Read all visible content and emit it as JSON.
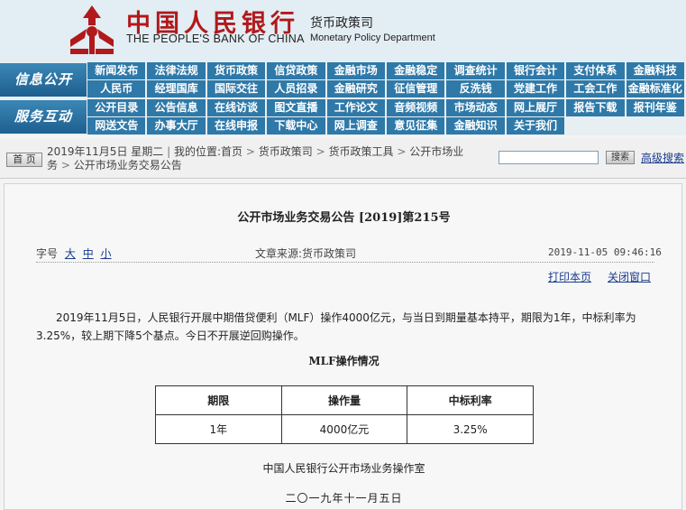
{
  "header": {
    "title_cn": "中国人民银行",
    "title_en": "THE PEOPLE'S BANK OF CHINA",
    "dept_cn": "货币政策司",
    "dept_en": "Monetary Policy Department",
    "logo_icon": "pboc-emblem-icon",
    "brand_red": "#b1191b",
    "nav_blue": "#2f79a9"
  },
  "nav": {
    "group1_label": "信息公开",
    "group1_items": [
      "新闻发布",
      "法律法规",
      "货币政策",
      "信贷政策",
      "金融市场",
      "金融稳定",
      "调查统计",
      "银行会计",
      "支付体系",
      "金融科技",
      "人民币",
      "经理国库",
      "国际交往",
      "人员招录",
      "金融研究",
      "征信管理",
      "反洗钱",
      "党建工作",
      "工会工作",
      "金融标准化"
    ],
    "group2_label": "服务互动",
    "group2_items": [
      "公开目录",
      "公告信息",
      "在线访谈",
      "图文直播",
      "工作论文",
      "音频视频",
      "市场动态",
      "网上展厅",
      "报告下载",
      "报刊年鉴",
      "网送文告",
      "办事大厅",
      "在线申报",
      "下载中心",
      "网上调查",
      "意见征集",
      "金融知识",
      "关于我们"
    ]
  },
  "breadcrumb": {
    "home_button": "首 页",
    "date": "2019年11月5日",
    "weekday": "星期二",
    "location_label": "我的位置:",
    "items": [
      "首页",
      "货币政策司",
      "货币政策工具",
      "公开市场业务",
      "公开市场业务交易公告"
    ],
    "search_button": "搜索",
    "advanced_search": "高级搜索"
  },
  "article": {
    "title": "公开市场业务交易公告 [2019]第215号",
    "font_size_label": "字号",
    "font_sizes": [
      "大",
      "中",
      "小"
    ],
    "source": "文章来源:货币政策司",
    "timestamp": "2019-11-05 09:46:16",
    "print_link": "打印本页",
    "close_link": "关闭窗口",
    "body": "2019年11月5日，人民银行开展中期借贷便利（MLF）操作4000亿元，与当日到期量基本持平，期限为1年，中标利率为3.25%，较上期下降5个基点。今日不开展逆回购操作。",
    "table_title": "MLF操作情况",
    "table": {
      "headers": [
        "期限",
        "操作量",
        "中标利率"
      ],
      "rows": [
        [
          "1年",
          "4000亿元",
          "3.25%"
        ]
      ]
    },
    "signature_org": "中国人民银行公开市场业务操作室",
    "signature_date": "二〇一九年十一月五日"
  }
}
